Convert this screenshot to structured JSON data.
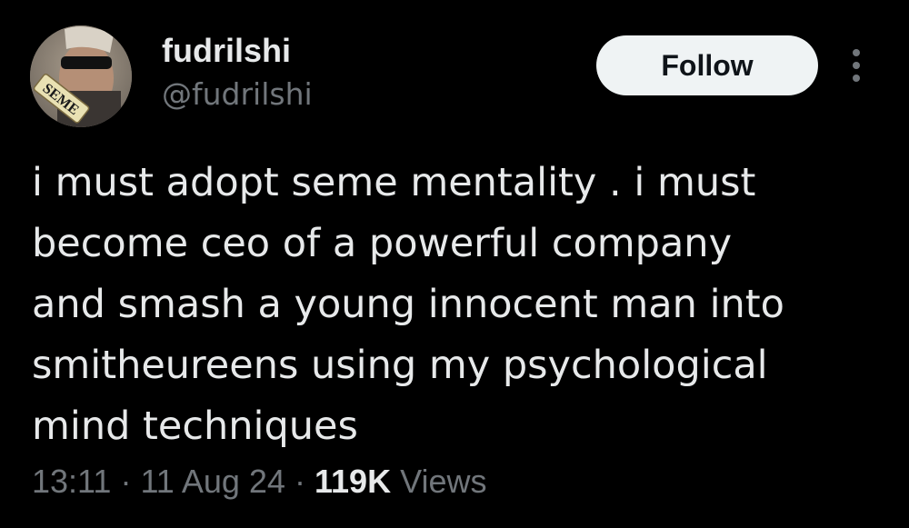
{
  "author": {
    "display_name": "fudrilshi",
    "handle": "@fudrilshi",
    "avatar_sign_text": "SEME"
  },
  "actions": {
    "follow_label": "Follow",
    "more_icon": "more-horizontal-icon"
  },
  "tweet": {
    "lines": [
      "i must adopt seme mentality . i must",
      "become ceo of a powerful company",
      "and smash a young innocent man into",
      "smitheureens using my psychological",
      "mind techniques"
    ]
  },
  "meta": {
    "time": "13:11",
    "separator": "·",
    "date": "11 Aug 24",
    "views_count": "119K",
    "views_label": "Views"
  },
  "colors": {
    "background": "#000000",
    "primary_text": "#e7e9ea",
    "secondary_text": "#71767b",
    "follow_bg": "#eff3f4",
    "follow_text": "#0f1419"
  }
}
